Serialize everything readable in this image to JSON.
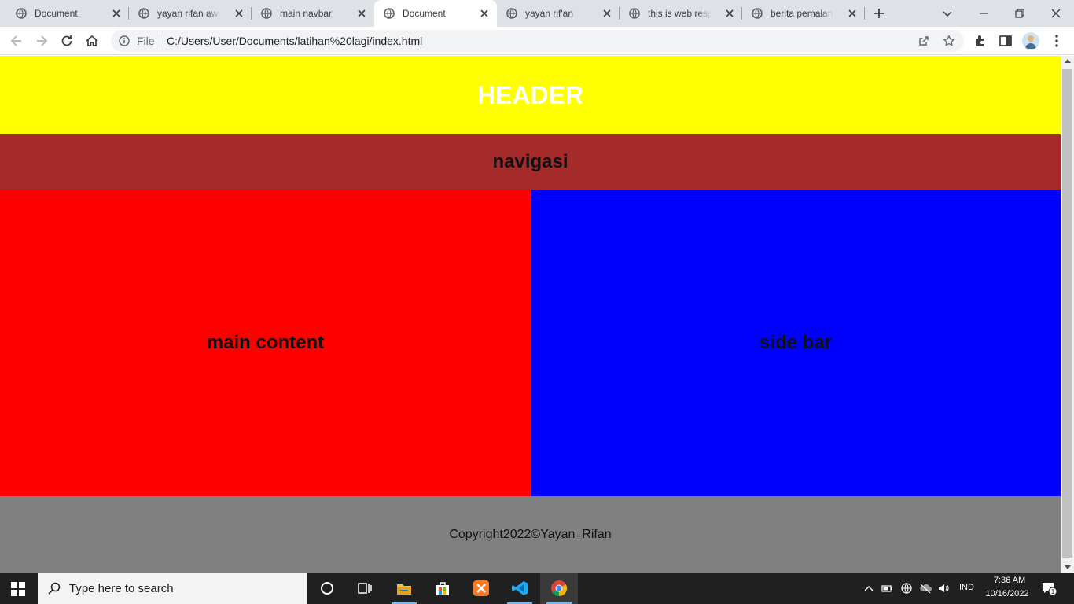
{
  "browser": {
    "tabs": [
      {
        "title": "Document",
        "active": false
      },
      {
        "title": "yayan rifan awalu",
        "active": false
      },
      {
        "title": "main navbar",
        "active": false
      },
      {
        "title": "Document",
        "active": true
      },
      {
        "title": "yayan rif'an",
        "active": false
      },
      {
        "title": "this is web respo",
        "active": false
      },
      {
        "title": "berita pemalang",
        "active": false
      }
    ],
    "address": {
      "scheme_label": "File",
      "url": "C:/Users/User/Documents/latihan%20lagi/index.html"
    }
  },
  "page": {
    "header": {
      "text": "HEADER",
      "background": "#ffff00",
      "color": "#ffffff"
    },
    "nav": {
      "text": "navigasi",
      "background": "#a52a2a"
    },
    "main": {
      "text": "main content",
      "background": "#ff0000"
    },
    "sidebar": {
      "text": "side bar",
      "background": "#0000ff"
    },
    "footer": {
      "text": "Copyright2022©Yayan_Rifan",
      "background": "#808080"
    }
  },
  "taskbar": {
    "search_placeholder": "Type here to search",
    "apps": [
      "cortana-icon",
      "task-view-icon",
      "file-explorer-icon",
      "microsoft-store-icon",
      "xampp-icon",
      "vscode-icon",
      "chrome-icon"
    ],
    "tray": {
      "language": "IND",
      "time": "7:36 AM",
      "date": "10/16/2022",
      "notification_count": "1"
    }
  }
}
